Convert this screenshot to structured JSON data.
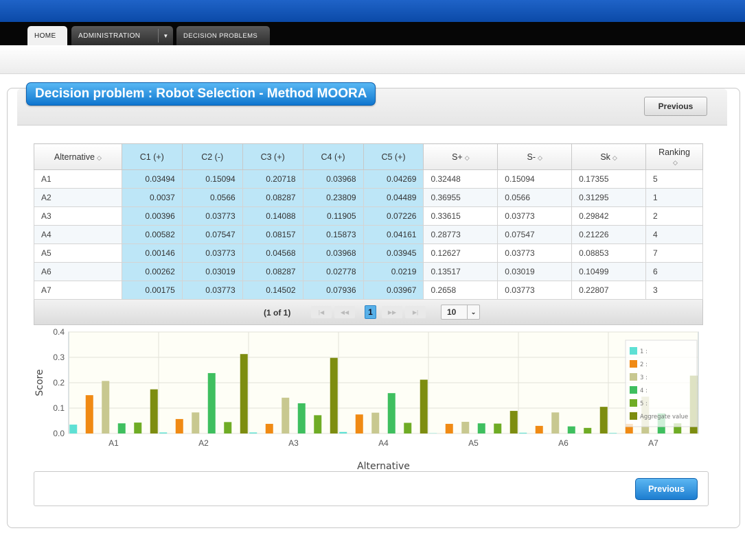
{
  "nav": {
    "home": "HOME",
    "administration": "ADMINISTRATION",
    "decision_problems": "DECISION PROBLEMS"
  },
  "page": {
    "title": "Decision problem : Robot Selection - Method MOORA",
    "previous_top": "Previous",
    "previous_bottom": "Previous"
  },
  "table": {
    "headers": [
      "Alternative",
      "C1 (+)",
      "C2 (-)",
      "C3 (+)",
      "C4 (+)",
      "C5 (+)",
      "S+",
      "S-",
      "Sk",
      "Ranking"
    ],
    "rows": [
      [
        "A1",
        "0.03494",
        "0.15094",
        "0.20718",
        "0.03968",
        "0.04269",
        "0.32448",
        "0.15094",
        "0.17355",
        "5"
      ],
      [
        "A2",
        "0.0037",
        "0.0566",
        "0.08287",
        "0.23809",
        "0.04489",
        "0.36955",
        "0.0566",
        "0.31295",
        "1"
      ],
      [
        "A3",
        "0.00396",
        "0.03773",
        "0.14088",
        "0.11905",
        "0.07226",
        "0.33615",
        "0.03773",
        "0.29842",
        "2"
      ],
      [
        "A4",
        "0.00582",
        "0.07547",
        "0.08157",
        "0.15873",
        "0.04161",
        "0.28773",
        "0.07547",
        "0.21226",
        "4"
      ],
      [
        "A5",
        "0.00146",
        "0.03773",
        "0.04568",
        "0.03968",
        "0.03945",
        "0.12627",
        "0.03773",
        "0.08853",
        "7"
      ],
      [
        "A6",
        "0.00262",
        "0.03019",
        "0.08287",
        "0.02778",
        "0.0219",
        "0.13517",
        "0.03019",
        "0.10499",
        "6"
      ],
      [
        "A7",
        "0.00175",
        "0.03773",
        "0.14502",
        "0.07936",
        "0.03967",
        "0.2658",
        "0.03773",
        "0.22807",
        "3"
      ]
    ],
    "pager_info": "(1 of 1)",
    "current_page": "1",
    "page_size": "10"
  },
  "chart_data": {
    "type": "bar",
    "categories": [
      "A1",
      "A2",
      "A3",
      "A4",
      "A5",
      "A6",
      "A7"
    ],
    "xlabel": "Alternative",
    "ylabel": "Score",
    "ylim": [
      0,
      0.4
    ],
    "yticks": [
      "0.0",
      "0.1",
      "0.2",
      "0.3",
      "0.4"
    ],
    "legend_position": "right",
    "series": [
      {
        "name": "1 :",
        "color": "#5ee0d4",
        "values": [
          0.035,
          0.004,
          0.004,
          0.006,
          0.001,
          0.003,
          0.002
        ]
      },
      {
        "name": "2 :",
        "color": "#f08a14",
        "values": [
          0.151,
          0.057,
          0.038,
          0.075,
          0.038,
          0.03,
          0.038
        ]
      },
      {
        "name": "3 :",
        "color": "#c8c890",
        "values": [
          0.207,
          0.083,
          0.141,
          0.082,
          0.046,
          0.083,
          0.145
        ]
      },
      {
        "name": "4 :",
        "color": "#3fbf5f",
        "values": [
          0.04,
          0.238,
          0.119,
          0.159,
          0.04,
          0.028,
          0.079
        ]
      },
      {
        "name": "5 :",
        "color": "#6fac25",
        "values": [
          0.043,
          0.045,
          0.072,
          0.042,
          0.039,
          0.022,
          0.04
        ]
      },
      {
        "name": "Aggregate value",
        "color": "#7d8d10",
        "values": [
          0.174,
          0.313,
          0.298,
          0.212,
          0.089,
          0.105,
          0.228
        ]
      }
    ]
  }
}
